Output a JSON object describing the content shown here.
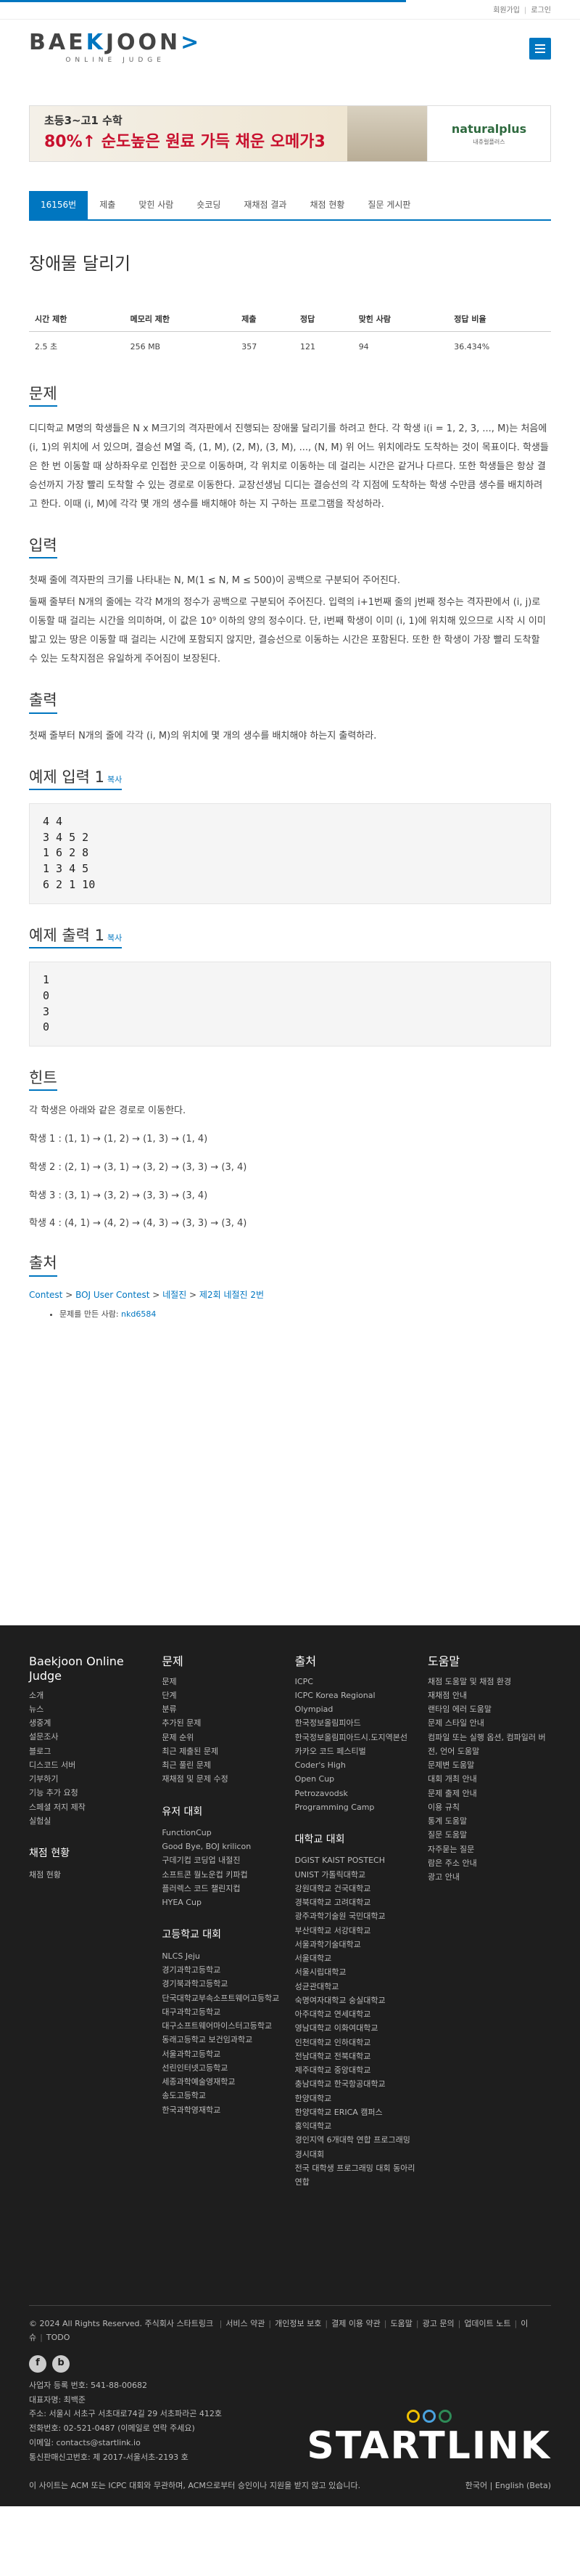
{
  "topbar": {
    "signup": "회원가입",
    "login": "로그인"
  },
  "logo": {
    "main_a": "BAE",
    "main_b": "K",
    "main_c": "JOON",
    "main_d": ">",
    "sub": "ONLINE JUDGE"
  },
  "banner": {
    "line1": "초등3~고1 수학",
    "line2": "80%↑ 순도높은 원료 가득 채운 오메가3",
    "brand": "naturalplus",
    "tag": "내츄럴플러스"
  },
  "tabs": [
    "16156번",
    "제출",
    "맞힌 사람",
    "숏코딩",
    "재채점 결과",
    "채점 현황",
    "질문 게시판"
  ],
  "problem": {
    "title": "장애물 달리기",
    "info_headers": [
      "시간 제한",
      "메모리 제한",
      "제출",
      "정답",
      "맞힌 사람",
      "정답 비율"
    ],
    "info_values": [
      "2.5 초",
      "256 MB",
      "357",
      "121",
      "94",
      "36.434%"
    ],
    "sec_desc": "문제",
    "desc": "디디학교 M명의 학생들은 N x M크기의 격자판에서 진행되는 장애물 달리기를 하려고 한다. 각 학생 i(i = 1, 2, 3, ..., M)는 처음에 (i, 1)의 위치에 서 있으며, 결승선 M열 즉, (1, M), (2, M), (3, M), ..., (N, M) 위 어느 위치에라도 도착하는 것이 목표이다. 학생들은 한 번 이동할 때 상하좌우로 인접한 곳으로 이동하며, 각 위치로 이동하는 데 걸리는 시간은 같거나 다르다. 또한 학생들은 항상 결승선까지 가장 빨리 도착할 수 있는 경로로 이동한다. 교장선생님 디디는 결승선의 각 지점에 도착하는 학생 수만큼 생수를 배치하려고 한다. 이때 (i, M)에 각각 몇 개의 생수를 배치해야 하는 지 구하는 프로그램을 작성하라.",
    "sec_input": "입력",
    "input1": "첫째 줄에 격자판의 크기를 나타내는 N, M(1 ≤ N, M ≤ 500)이 공백으로 구분되어 주어진다.",
    "input2": "둘째 줄부터 N개의 줄에는 각각 M개의 정수가 공백으로 구분되어 주어진다. 입력의 i+1번째 줄의 j번째 정수는 격자판에서 (i, j)로 이동할 때 걸리는 시간을 의미하며, 이 값은 10⁹ 이하의 양의 정수이다. 단, i번째 학생이 이미 (i, 1)에 위치해 있으므로 시작 시 이미 밟고 있는 땅은 이동할 때 걸리는 시간에 포함되지 않지만, 결승선으로 이동하는 시간은 포함된다. 또한 한 학생이 가장 빨리 도착할 수 있는 도착지점은 유일하게 주어짐이 보장된다.",
    "sec_output": "출력",
    "output": "첫째 줄부터 N개의 줄에 각각 (i, M)의 위치에 몇 개의 생수를 배치해야 하는지 출력하라.",
    "sec_sample_in": "예제 입력 1",
    "sample_in": "4 4\n3 4 5 2\n1 6 2 8\n1 3 4 5\n6 2 1 10",
    "sec_sample_out": "예제 출력 1",
    "sample_out": "1\n0\n3\n0",
    "copy": "복사",
    "sec_hint": "힌트",
    "hint_intro": "각 학생은 아래와 같은 경로로 이동한다.",
    "hints": [
      "학생 1 : (1, 1) → (1, 2) → (1, 3) → (1, 4)",
      "학생 2 : (2, 1) → (3, 1) → (3, 2) → (3, 3) → (3, 4)",
      "학생 3 : (3, 1) → (3, 2) → (3, 3) → (3, 4)",
      "학생 4 : (4, 1) → (4, 2) → (4, 3) → (3, 3) → (3, 4)"
    ],
    "sec_source": "출처",
    "source_links": [
      "Contest",
      "BOJ User Contest",
      "네절진",
      "제2회 네절진 2번"
    ],
    "source_sep": " > ",
    "source_maker_label": "문제를 만든 사람: ",
    "source_maker": "nkd6584"
  },
  "footer": {
    "cols": [
      {
        "title": "Baekjoon Online Judge",
        "items": [
          "소개",
          "뉴스",
          "생중계",
          "설문조사",
          "블로그",
          "디스코드 서버",
          "기부하기",
          "기능 추가 요청",
          "스페셜 저지 제작",
          "실험실"
        ],
        "sub": "채점 현황",
        "sub_items": [
          "채점 현황"
        ]
      },
      {
        "title": "문제",
        "items": [
          "문제",
          "단계",
          "분류",
          "추가된 문제",
          "문제 순위",
          "최근 제출된 문제",
          "최근 풀린 문제",
          "재채점 및 문제 수정"
        ],
        "sub": "유저 대회",
        "sub_items": [
          "FunctionCup",
          "Good Bye, BOJ krilicon",
          "구데기컵 코딩업 내절진",
          "소프트콘 월노운컵 키파컵",
          "플러렉스 코드 챌린지컵",
          "HYEA Cup"
        ],
        "sub2": "고등학교 대회",
        "sub2_items": [
          "NLCS Jeju",
          "경기과학고등학교",
          "경기북과학고등학교",
          "단국대학교부속소프트웨어고등학교",
          "대구과학고등학교",
          "대구소프트웨어마이스터고등학교",
          "동래고등학교 보건임과학교",
          "서울과학고등학교",
          "선린인터넷고등학교",
          "세종과학예술영재학교",
          "송도고등학교",
          "한국과학영재학교"
        ]
      },
      {
        "title": "출처",
        "items": [
          "ICPC",
          "ICPC Korea Regional",
          "Olympiad",
          "한국정보올림피아드",
          "한국정보올림피아드시.도지역본선",
          "카카오 코드 페스티벌",
          "Coder's High",
          "Open Cup",
          "Petrozavodsk",
          "Programming Camp"
        ],
        "sub": "대학교 대회",
        "sub_items": [
          "DGIST KAIST POSTECH",
          "UNIST 가톨릭대학교",
          "강원대학교 건국대학교",
          "경북대학교 고려대학교",
          "광주과학기술원 국민대학교",
          "부산대학교 서강대학교",
          "서울과학기술대학교",
          "서울대학교",
          "서울시립대학교",
          "성균관대학교",
          "숙명여자대학교 숭실대학교",
          "아주대학교 연세대학교",
          "영남대학교 이화여대학교",
          "인천대학교 인하대학교",
          "전남대학교 전북대학교",
          "제주대학교 중앙대학교",
          "충남대학교 한국항공대학교",
          "한양대학교",
          "한양대학교 ERICA 캠퍼스",
          "홍익대학교",
          "경인지역 6개대학 연합 프로그래밍 경시대회",
          "전국 대학생 프로그래밍 대회 동아리 연합"
        ]
      },
      {
        "title": "도움말",
        "items": [
          "채점 도움말 및 채점 환경",
          "재채점 안내",
          "랜타임 에러 도움말",
          "문제 스타일 안내",
          "컴파일 또는 실행 옵션, 컴파일러 버전, 언어 도움말",
          "문제변 도움말",
          "대회 개최 안내",
          "문제 출제 안내",
          "이용 규칙",
          "통계 도움말",
          "질문 도움말",
          "자주묻는 질문",
          "람은 주소 안내",
          "광고 안내"
        ]
      }
    ],
    "copyright": "© 2024 All Rights Reserved. 주식회사 스타트링크",
    "links": [
      "서비스 약관",
      "개인정보 보호",
      "결제 이용 약관",
      "도움말",
      "광고 문의",
      "업데이트 노트",
      "이슈",
      "TODO"
    ],
    "company": [
      "사업자 등록 번호: 541-88-00682",
      "대표자명: 최백준",
      "주소: 서울시 서초구 서초대로74길 29 서초파라곤 412호",
      "전화번호: 02-521-0487 (이메일로 연락 주세요)",
      "이메일: contacts@startlink.io",
      "통신판매신고번호: 제 2017-서울서초-2193 호"
    ],
    "brand": "STARTLINK",
    "disclaimer": "이 사이트는 ACM 또는 ICPC 대회와 무관하며, ACM으로부터 승인이나 지원을 받지 않고 있습니다.",
    "langs": "한국어 | English (Beta)"
  }
}
